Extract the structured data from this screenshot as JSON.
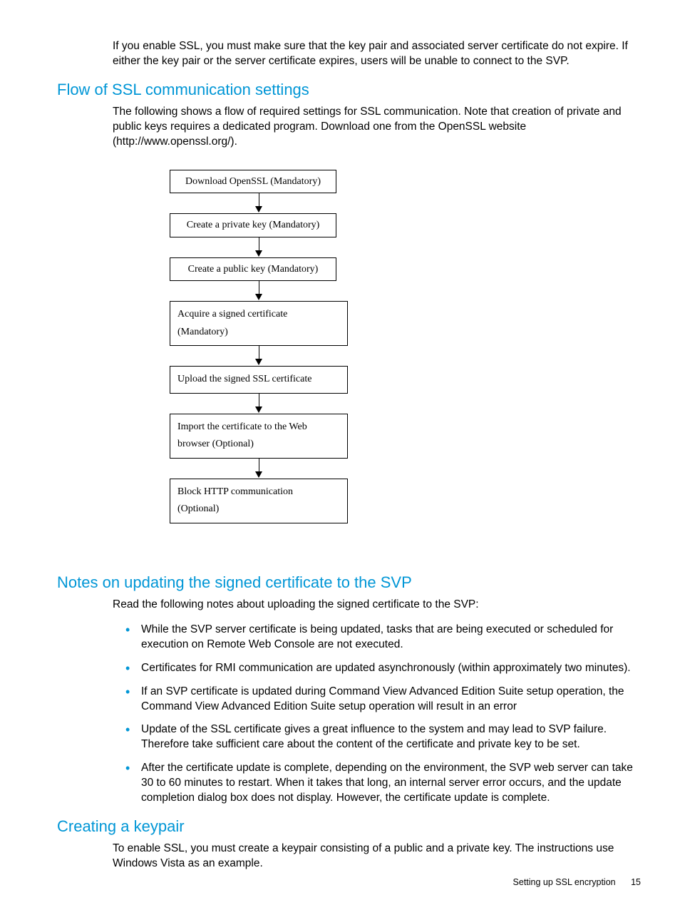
{
  "intro": "If you enable SSL, you must make sure that the key pair and associated server certificate do not expire. If either the key pair or the server certificate expires, users will be unable to connect to the SVP.",
  "section1": {
    "heading": "Flow of SSL communication settings",
    "para": "The following shows a flow of required settings for SSL communication. Note that creation of private and public keys requires a dedicated program. Download one from the OpenSSL website (http://www.openssl.org/)."
  },
  "flow": {
    "box1": "Download OpenSSL (Mandatory)",
    "box2": "Create a private key (Mandatory)",
    "box3": "Create a public key (Mandatory)",
    "box4a": "Acquire a signed certificate",
    "box4b": "(Mandatory)",
    "box5": "Upload the signed SSL certificate",
    "box6a": "Import the certificate to the Web",
    "box6b": "browser (Optional)",
    "box7a": "Block HTTP communication",
    "box7b": "(Optional)"
  },
  "section2": {
    "heading": "Notes on updating the signed certificate to the SVP",
    "para": "Read the following notes about uploading the signed certificate to the SVP:",
    "bullets": [
      "While the SVP server certificate is being updated, tasks that are being executed or scheduled for execution on Remote Web Console are not executed.",
      "Certificates for RMI communication are updated asynchronously (within approximately two minutes).",
      "If an SVP certificate is updated during Command View Advanced Edition Suite setup operation, the Command View Advanced Edition Suite setup operation will result in an error",
      "Update of the SSL certificate gives a great influence to the system and may lead to SVP failure. Therefore take sufficient care about the content of the certificate and private key to be set.",
      "After the certificate update is complete, depending on the environment, the SVP web server can take 30 to 60 minutes to restart. When it takes that long, an internal server error occurs, and the update completion dialog box does not display. However, the certificate update is complete."
    ]
  },
  "section3": {
    "heading": "Creating a keypair",
    "para": "To enable SSL, you must create a keypair consisting of a public and a private key. The instructions use Windows Vista as an example."
  },
  "footer": {
    "title": "Setting up SSL encryption",
    "pagenum": "15"
  }
}
